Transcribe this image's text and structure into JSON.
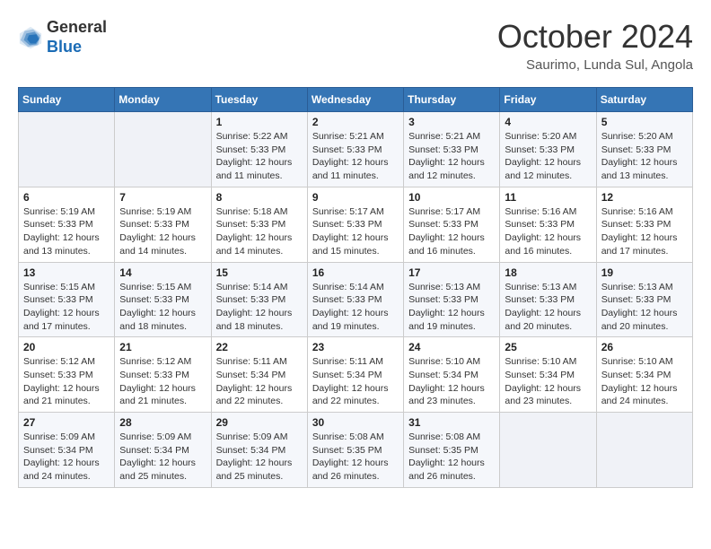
{
  "header": {
    "logo_line1": "General",
    "logo_line2": "Blue",
    "month": "October 2024",
    "location": "Saurimo, Lunda Sul, Angola"
  },
  "weekdays": [
    "Sunday",
    "Monday",
    "Tuesday",
    "Wednesday",
    "Thursday",
    "Friday",
    "Saturday"
  ],
  "weeks": [
    [
      {
        "day": "",
        "info": ""
      },
      {
        "day": "",
        "info": ""
      },
      {
        "day": "1",
        "info": "Sunrise: 5:22 AM\nSunset: 5:33 PM\nDaylight: 12 hours\nand 11 minutes."
      },
      {
        "day": "2",
        "info": "Sunrise: 5:21 AM\nSunset: 5:33 PM\nDaylight: 12 hours\nand 11 minutes."
      },
      {
        "day": "3",
        "info": "Sunrise: 5:21 AM\nSunset: 5:33 PM\nDaylight: 12 hours\nand 12 minutes."
      },
      {
        "day": "4",
        "info": "Sunrise: 5:20 AM\nSunset: 5:33 PM\nDaylight: 12 hours\nand 12 minutes."
      },
      {
        "day": "5",
        "info": "Sunrise: 5:20 AM\nSunset: 5:33 PM\nDaylight: 12 hours\nand 13 minutes."
      }
    ],
    [
      {
        "day": "6",
        "info": "Sunrise: 5:19 AM\nSunset: 5:33 PM\nDaylight: 12 hours\nand 13 minutes."
      },
      {
        "day": "7",
        "info": "Sunrise: 5:19 AM\nSunset: 5:33 PM\nDaylight: 12 hours\nand 14 minutes."
      },
      {
        "day": "8",
        "info": "Sunrise: 5:18 AM\nSunset: 5:33 PM\nDaylight: 12 hours\nand 14 minutes."
      },
      {
        "day": "9",
        "info": "Sunrise: 5:17 AM\nSunset: 5:33 PM\nDaylight: 12 hours\nand 15 minutes."
      },
      {
        "day": "10",
        "info": "Sunrise: 5:17 AM\nSunset: 5:33 PM\nDaylight: 12 hours\nand 16 minutes."
      },
      {
        "day": "11",
        "info": "Sunrise: 5:16 AM\nSunset: 5:33 PM\nDaylight: 12 hours\nand 16 minutes."
      },
      {
        "day": "12",
        "info": "Sunrise: 5:16 AM\nSunset: 5:33 PM\nDaylight: 12 hours\nand 17 minutes."
      }
    ],
    [
      {
        "day": "13",
        "info": "Sunrise: 5:15 AM\nSunset: 5:33 PM\nDaylight: 12 hours\nand 17 minutes."
      },
      {
        "day": "14",
        "info": "Sunrise: 5:15 AM\nSunset: 5:33 PM\nDaylight: 12 hours\nand 18 minutes."
      },
      {
        "day": "15",
        "info": "Sunrise: 5:14 AM\nSunset: 5:33 PM\nDaylight: 12 hours\nand 18 minutes."
      },
      {
        "day": "16",
        "info": "Sunrise: 5:14 AM\nSunset: 5:33 PM\nDaylight: 12 hours\nand 19 minutes."
      },
      {
        "day": "17",
        "info": "Sunrise: 5:13 AM\nSunset: 5:33 PM\nDaylight: 12 hours\nand 19 minutes."
      },
      {
        "day": "18",
        "info": "Sunrise: 5:13 AM\nSunset: 5:33 PM\nDaylight: 12 hours\nand 20 minutes."
      },
      {
        "day": "19",
        "info": "Sunrise: 5:13 AM\nSunset: 5:33 PM\nDaylight: 12 hours\nand 20 minutes."
      }
    ],
    [
      {
        "day": "20",
        "info": "Sunrise: 5:12 AM\nSunset: 5:33 PM\nDaylight: 12 hours\nand 21 minutes."
      },
      {
        "day": "21",
        "info": "Sunrise: 5:12 AM\nSunset: 5:33 PM\nDaylight: 12 hours\nand 21 minutes."
      },
      {
        "day": "22",
        "info": "Sunrise: 5:11 AM\nSunset: 5:34 PM\nDaylight: 12 hours\nand 22 minutes."
      },
      {
        "day": "23",
        "info": "Sunrise: 5:11 AM\nSunset: 5:34 PM\nDaylight: 12 hours\nand 22 minutes."
      },
      {
        "day": "24",
        "info": "Sunrise: 5:10 AM\nSunset: 5:34 PM\nDaylight: 12 hours\nand 23 minutes."
      },
      {
        "day": "25",
        "info": "Sunrise: 5:10 AM\nSunset: 5:34 PM\nDaylight: 12 hours\nand 23 minutes."
      },
      {
        "day": "26",
        "info": "Sunrise: 5:10 AM\nSunset: 5:34 PM\nDaylight: 12 hours\nand 24 minutes."
      }
    ],
    [
      {
        "day": "27",
        "info": "Sunrise: 5:09 AM\nSunset: 5:34 PM\nDaylight: 12 hours\nand 24 minutes."
      },
      {
        "day": "28",
        "info": "Sunrise: 5:09 AM\nSunset: 5:34 PM\nDaylight: 12 hours\nand 25 minutes."
      },
      {
        "day": "29",
        "info": "Sunrise: 5:09 AM\nSunset: 5:34 PM\nDaylight: 12 hours\nand 25 minutes."
      },
      {
        "day": "30",
        "info": "Sunrise: 5:08 AM\nSunset: 5:35 PM\nDaylight: 12 hours\nand 26 minutes."
      },
      {
        "day": "31",
        "info": "Sunrise: 5:08 AM\nSunset: 5:35 PM\nDaylight: 12 hours\nand 26 minutes."
      },
      {
        "day": "",
        "info": ""
      },
      {
        "day": "",
        "info": ""
      }
    ]
  ]
}
